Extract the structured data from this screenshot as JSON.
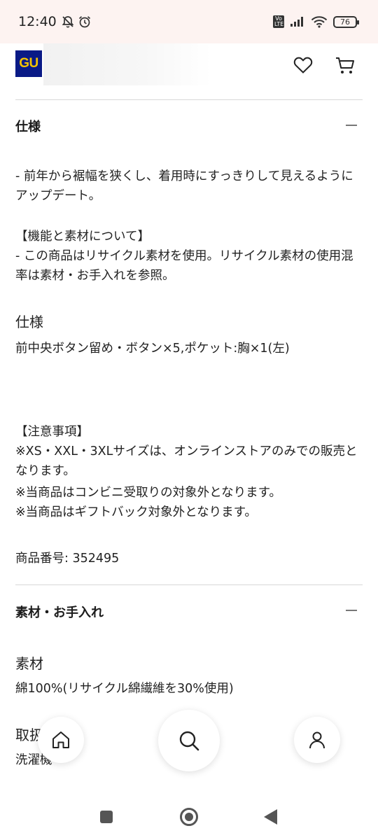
{
  "status_bar": {
    "time": "12:40",
    "volte_label": "Vo LTE",
    "battery": "76",
    "icons": [
      "mute-bell-icon",
      "alarm-icon",
      "signal-icon",
      "wifi-icon",
      "battery-icon"
    ]
  },
  "header": {
    "logo_text": "GU",
    "brand_colors": {
      "logo_bg": "#0a1a86",
      "logo_text": "#f4c300"
    },
    "icons": [
      "heart-icon",
      "cart-icon"
    ]
  },
  "spec_section": {
    "title": "仕様",
    "paragraph1": "- 前年から裾幅を狭くし、着用時にすっきりして見えるようにアップデート。",
    "function_heading": "【機能と素材について】",
    "function_body": "- この商品はリサイクル素材を使用。リサイクル素材の使用混率は素材・お手入れを参照。",
    "spec_heading": "仕様",
    "spec_body": "前中央ボタン留め・ボタン×5,ポケット:胸×1(左)",
    "notes_heading": "【注意事項】",
    "note1": "※XS・XXL・3XLサイズは、オンラインストアのみでの販売となります。",
    "note2": "※当商品はコンビニ受取りの対象外となります。",
    "note3": "※当商品はギフトバック対象外となります。",
    "product_number": "商品番号: 352495"
  },
  "material_section": {
    "title": "素材・お手入れ",
    "material_heading": "素材",
    "material_body": "綿100%(リサイクル綿繊維を30%使用)",
    "care_heading_partial": "取扱",
    "care_body_partial": "洗濯機"
  },
  "bottom_nav": {
    "icons": [
      "home-icon",
      "search-icon",
      "account-icon"
    ]
  },
  "system_nav": {
    "icons": [
      "recents-icon",
      "home-circle-icon",
      "back-icon"
    ]
  }
}
